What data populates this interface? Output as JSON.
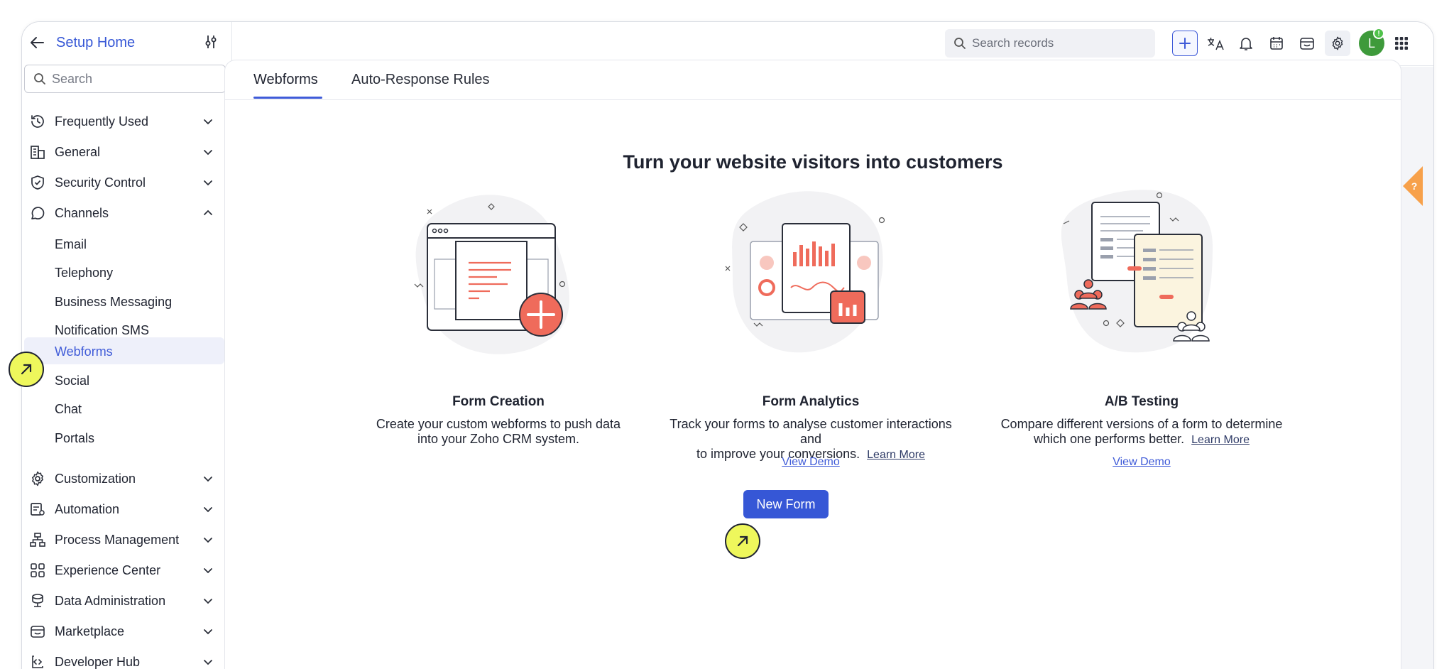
{
  "sidebar": {
    "title": "Setup Home",
    "search_placeholder": "Search",
    "groups_top": [
      {
        "label": "Frequently Used",
        "icon": "history-icon"
      },
      {
        "label": "General",
        "icon": "building-icon"
      },
      {
        "label": "Security Control",
        "icon": "shield-icon"
      },
      {
        "label": "Channels",
        "icon": "chat-bubble-icon"
      }
    ],
    "channels": [
      "Email",
      "Telephony",
      "Business Messaging",
      "Notification SMS",
      "Webforms",
      "Social",
      "Chat",
      "Portals"
    ],
    "active_channel": "Webforms",
    "groups_bottom": [
      {
        "label": "Customization",
        "icon": "gear-icon"
      },
      {
        "label": "Automation",
        "icon": "automation-icon"
      },
      {
        "label": "Process Management",
        "icon": "process-icon"
      },
      {
        "label": "Experience Center",
        "icon": "grid-icon"
      },
      {
        "label": "Data Administration",
        "icon": "database-icon"
      },
      {
        "label": "Marketplace",
        "icon": "store-icon"
      },
      {
        "label": "Developer Hub",
        "icon": "code-icon"
      }
    ]
  },
  "topbar": {
    "search_placeholder": "Search records",
    "avatar_initial": "L",
    "badge": "!"
  },
  "tabs": [
    "Webforms",
    "Auto-Response Rules"
  ],
  "hero": {
    "title": "Turn your website visitors into customers"
  },
  "features": [
    {
      "title": "Form Creation",
      "desc_line1": "Create your custom webforms to push data",
      "desc_line2": "into your Zoho CRM system.",
      "learn_more": "",
      "demo": ""
    },
    {
      "title": "Form Analytics",
      "desc_line1": "Track your forms to analyse customer interactions and",
      "desc_line2": "to improve your conversions.",
      "learn_more": "Learn More",
      "demo": "View Demo"
    },
    {
      "title": "A/B Testing",
      "desc_line1": "Compare different versions of a form to determine",
      "desc_line2": "which one performs better.",
      "learn_more": "Learn More",
      "demo": "View Demo"
    }
  ],
  "new_form_label": "New Form",
  "help_label": "?",
  "colors": {
    "accent": "#3657d6",
    "illustration_red": "#ef6b5b"
  }
}
